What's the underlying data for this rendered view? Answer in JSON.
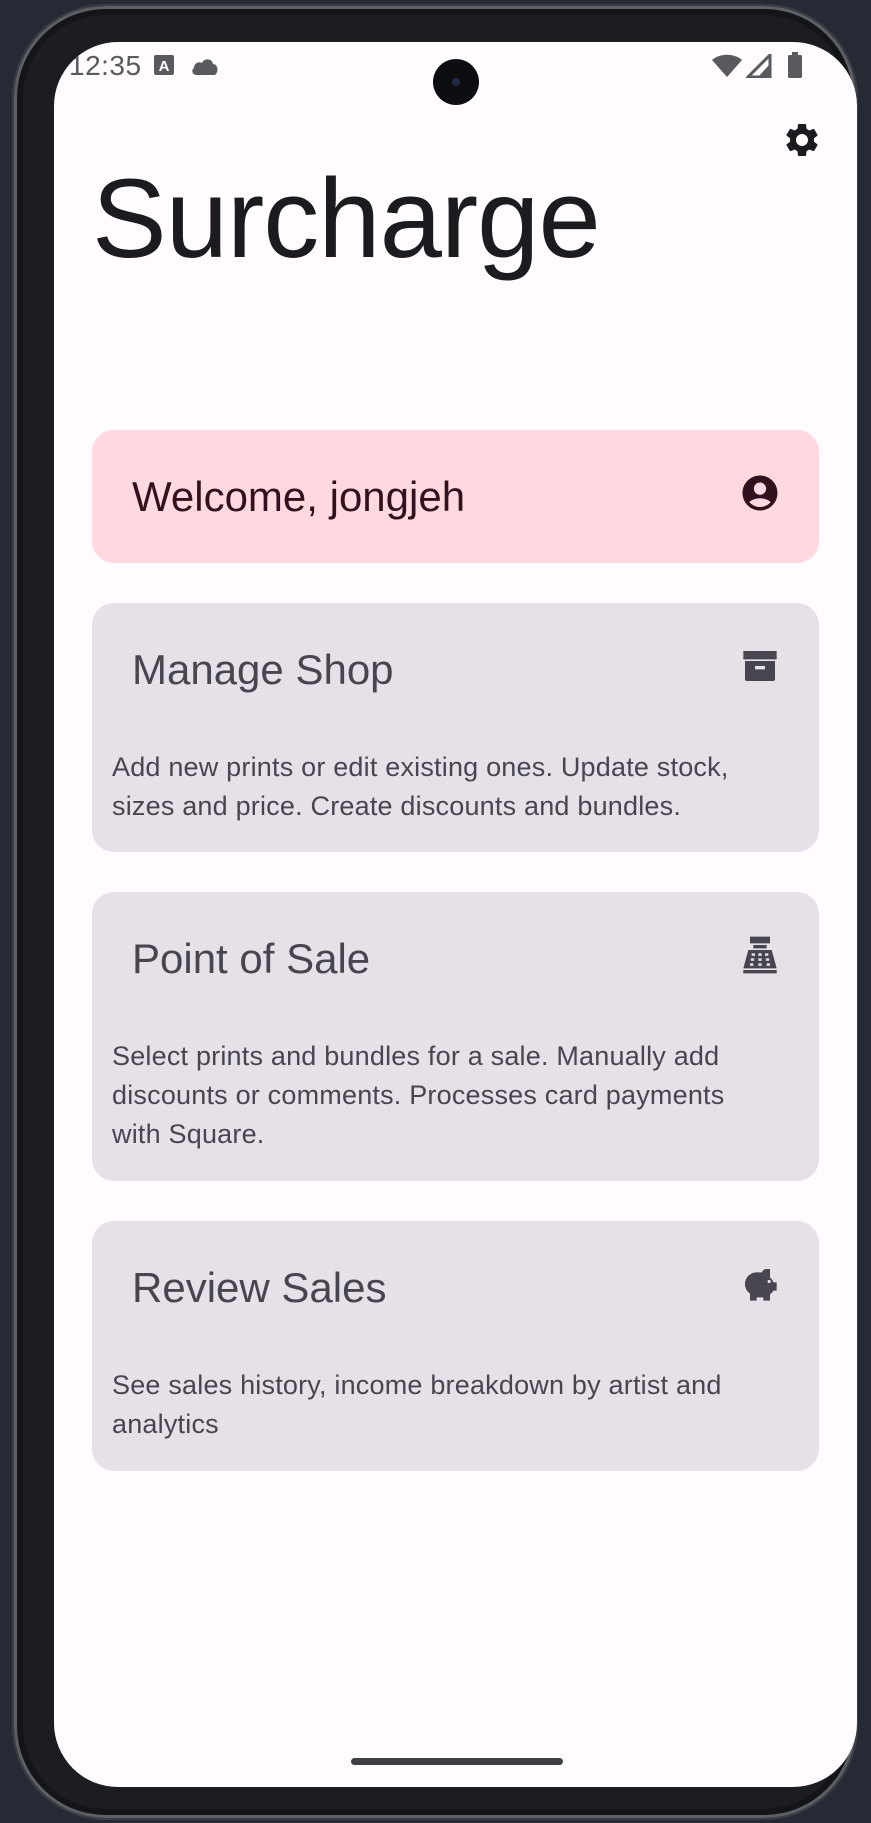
{
  "status_bar": {
    "time": "12:35",
    "left_icons": [
      "text-notification-icon",
      "cloud-icon"
    ],
    "right_icons": [
      "wifi-icon",
      "cellular-signal-icon",
      "battery-icon"
    ]
  },
  "header": {
    "title": "Surcharge",
    "settings_icon": "gear-icon"
  },
  "welcome_card": {
    "label": "Welcome, jongjeh",
    "icon": "account-circle-icon"
  },
  "menu_cards": [
    {
      "title": "Manage Shop",
      "icon": "archive-box-icon",
      "description": "Add new prints or edit existing ones. Update stock, sizes and price. Create discounts and bundles."
    },
    {
      "title": "Point of Sale",
      "icon": "cash-register-icon",
      "description": "Select prints and bundles for a sale. Manually add discounts or comments. Processes card payments with Square."
    },
    {
      "title": "Review Sales",
      "icon": "piggy-bank-icon",
      "description": "See sales history, income breakdown by artist and analytics"
    }
  ],
  "colors": {
    "background": "#fffbfe",
    "welcome_card": "#ffd8e0",
    "menu_card": "#e6e0e9",
    "text_primary": "#1c1b1f",
    "text_secondary": "#49454f"
  }
}
